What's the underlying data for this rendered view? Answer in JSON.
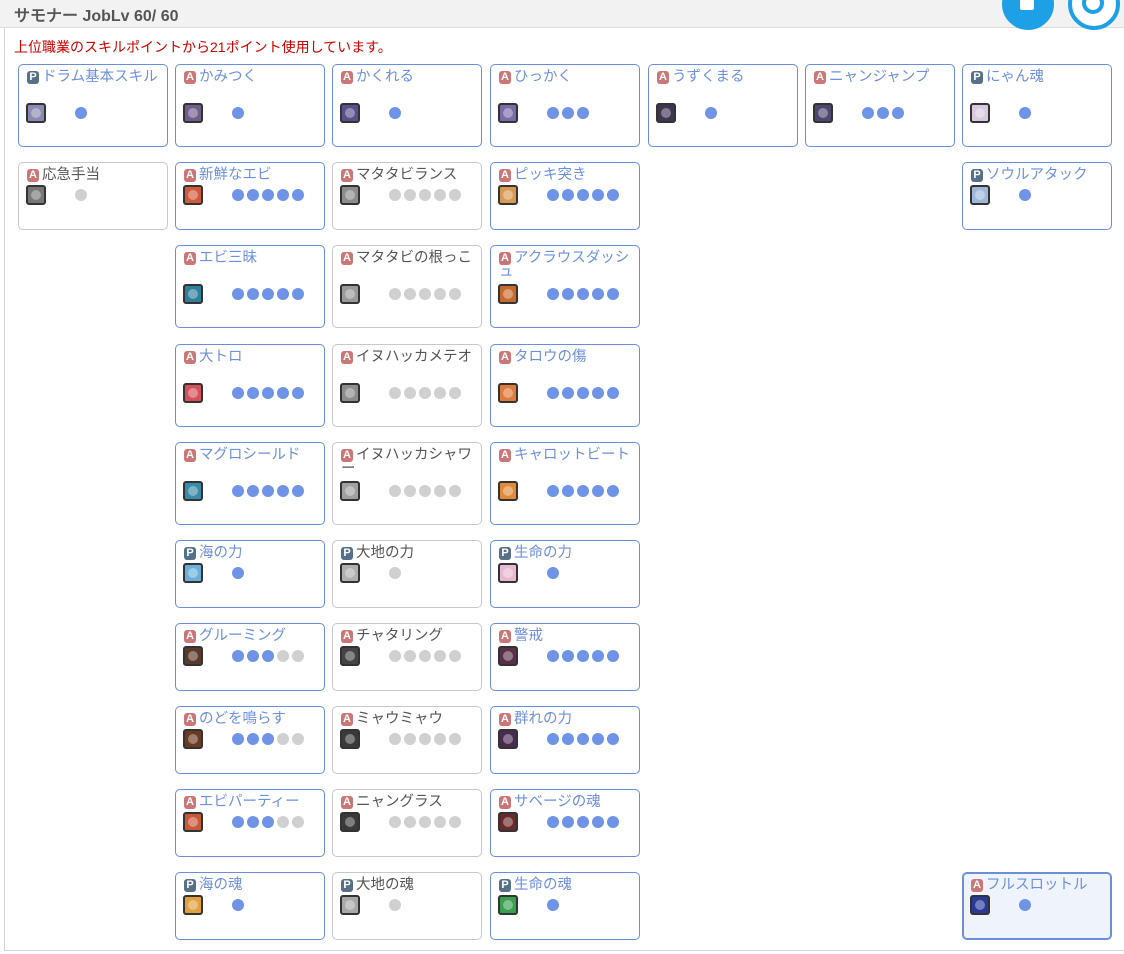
{
  "header": {
    "title": "サモナー JobLv 60/ 60"
  },
  "notice": "上位職業のスキルポイントから21ポイント使用しています。",
  "skills": [
    {
      "name": "ドラム基本スキル",
      "type": "P",
      "max": 1,
      "level": 1,
      "icon_color": "#8a8ab0",
      "active": true
    },
    {
      "name": "かみつく",
      "type": "A",
      "max": 1,
      "level": 1,
      "icon_color": "#6e5f8a",
      "active": true
    },
    {
      "name": "かくれる",
      "type": "A",
      "max": 1,
      "level": 1,
      "icon_color": "#5b4f8d",
      "active": true
    },
    {
      "name": "ひっかく",
      "type": "A",
      "max": 3,
      "level": 3,
      "icon_color": "#7a6aa8",
      "active": true
    },
    {
      "name": "うずくまる",
      "type": "A",
      "max": 1,
      "level": 1,
      "icon_color": "#3e3550",
      "active": true
    },
    {
      "name": "ニャンジャンプ",
      "type": "A",
      "max": 3,
      "level": 3,
      "icon_color": "#4e4870",
      "active": true
    },
    {
      "name": "にゃん魂",
      "type": "P",
      "max": 1,
      "level": 1,
      "icon_color": "#d8c8e0",
      "active": true
    },
    {
      "name": "応急手当",
      "type": "A",
      "max": 1,
      "level": 0,
      "icon_color": "#777777",
      "active": false
    },
    {
      "name": "新鮮なエビ",
      "type": "A",
      "max": 5,
      "level": 5,
      "icon_color": "#d05a3a",
      "active": true
    },
    {
      "name": "マタタビランス",
      "type": "A",
      "max": 5,
      "level": 0,
      "icon_color": "#8c8c8c",
      "active": false
    },
    {
      "name": "ピッキ突き",
      "type": "A",
      "max": 5,
      "level": 5,
      "icon_color": "#d89a52",
      "active": true
    },
    {
      "name": "ソウルアタック",
      "type": "P",
      "max": 1,
      "level": 1,
      "icon_color": "#9fb8d8",
      "active": true
    },
    {
      "name": "エビ三昧",
      "type": "A",
      "max": 5,
      "level": 5,
      "icon_color": "#2f7f9a",
      "active": true
    },
    {
      "name": "マタタビの根っこ",
      "type": "A",
      "max": 5,
      "level": 0,
      "icon_color": "#9a9a9a",
      "active": false
    },
    {
      "name": "アクラウスダッシュ",
      "type": "A",
      "max": 5,
      "level": 5,
      "icon_color": "#c86a2e",
      "active": true
    },
    {
      "name": "大トロ",
      "type": "A",
      "max": 5,
      "level": 5,
      "icon_color": "#d4505a",
      "active": true
    },
    {
      "name": "イヌハッカメテオ",
      "type": "A",
      "max": 5,
      "level": 0,
      "icon_color": "#8d8d8d",
      "active": false
    },
    {
      "name": "タロウの傷",
      "type": "A",
      "max": 5,
      "level": 5,
      "icon_color": "#e07a3a",
      "active": true
    },
    {
      "name": "マグロシールド",
      "type": "A",
      "max": 5,
      "level": 5,
      "icon_color": "#3a8aa8",
      "active": true
    },
    {
      "name": "イヌハッカシャワー",
      "type": "A",
      "max": 5,
      "level": 0,
      "icon_color": "#a0a0a0",
      "active": false
    },
    {
      "name": "キャロットビート",
      "type": "A",
      "max": 5,
      "level": 5,
      "icon_color": "#e08a3a",
      "active": true
    },
    {
      "name": "海の力",
      "type": "P",
      "max": 1,
      "level": 1,
      "icon_color": "#6ab0d8",
      "active": true
    },
    {
      "name": "大地の力",
      "type": "P",
      "max": 1,
      "level": 0,
      "icon_color": "#b0b0b0",
      "active": false
    },
    {
      "name": "生命の力",
      "type": "P",
      "max": 1,
      "level": 1,
      "icon_color": "#e8b8d0",
      "active": true
    },
    {
      "name": "グルーミング",
      "type": "A",
      "max": 5,
      "level": 3,
      "icon_color": "#5a3a2a",
      "active": true
    },
    {
      "name": "チャタリング",
      "type": "A",
      "max": 5,
      "level": 0,
      "icon_color": "#444444",
      "active": false
    },
    {
      "name": "警戒",
      "type": "A",
      "max": 5,
      "level": 5,
      "icon_color": "#5a3048",
      "active": true
    },
    {
      "name": "のどを鳴らす",
      "type": "A",
      "max": 5,
      "level": 3,
      "icon_color": "#6a3a22",
      "active": true
    },
    {
      "name": "ミャウミャウ",
      "type": "A",
      "max": 5,
      "level": 0,
      "icon_color": "#3a3a3a",
      "active": false
    },
    {
      "name": "群れの力",
      "type": "A",
      "max": 5,
      "level": 5,
      "icon_color": "#4a2a50",
      "active": true
    },
    {
      "name": "エビパーティー",
      "type": "A",
      "max": 5,
      "level": 3,
      "icon_color": "#c85a3a",
      "active": true
    },
    {
      "name": "ニャングラス",
      "type": "A",
      "max": 5,
      "level": 0,
      "icon_color": "#3a3a3a",
      "active": false
    },
    {
      "name": "サベージの魂",
      "type": "A",
      "max": 5,
      "level": 5,
      "icon_color": "#6a2a2a",
      "active": true
    },
    {
      "name": "海の魂",
      "type": "P",
      "max": 1,
      "level": 1,
      "icon_color": "#e0a040",
      "active": true
    },
    {
      "name": "大地の魂",
      "type": "P",
      "max": 1,
      "level": 0,
      "icon_color": "#a8a8a8",
      "active": false
    },
    {
      "name": "生命の魂",
      "type": "P",
      "max": 1,
      "level": 1,
      "icon_color": "#3aa050",
      "active": true
    },
    {
      "name": "フルスロットル",
      "type": "A",
      "max": 1,
      "level": 1,
      "icon_color": "#2a3a9a",
      "active": true
    }
  ]
}
